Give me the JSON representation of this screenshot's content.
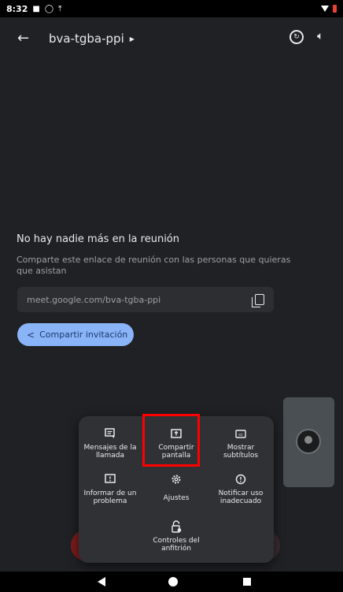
{
  "status_bar": {
    "time": "8:32"
  },
  "app_bar": {
    "meeting_title": "bva-tgba-ppi"
  },
  "empty_state": {
    "title": "No hay nadie más en la reunión",
    "description": "Comparte este enlace de reunión con las personas que quieras que asistan",
    "link": "meet.google.com/bva-tgba-ppi",
    "share_button": "Compartir invitación"
  },
  "menu": {
    "items": [
      {
        "label": "Mensajes de la llamada",
        "icon": "chat-icon"
      },
      {
        "label": "Compartir pantalla",
        "icon": "present-screen-icon"
      },
      {
        "label": "Mostrar subtítulos",
        "icon": "closed-caption-icon"
      },
      {
        "label": "Informar de un problema",
        "icon": "feedback-icon"
      },
      {
        "label": "Ajustes",
        "icon": "settings-icon"
      },
      {
        "label": "Notificar uso inadecuado",
        "icon": "report-icon"
      },
      {
        "label": "Controles del anfitrión",
        "icon": "host-lock-icon"
      }
    ]
  },
  "colors": {
    "accent": "#8ab4f8",
    "highlight": "#ff0000",
    "background": "#202124",
    "sheet": "#303134"
  }
}
